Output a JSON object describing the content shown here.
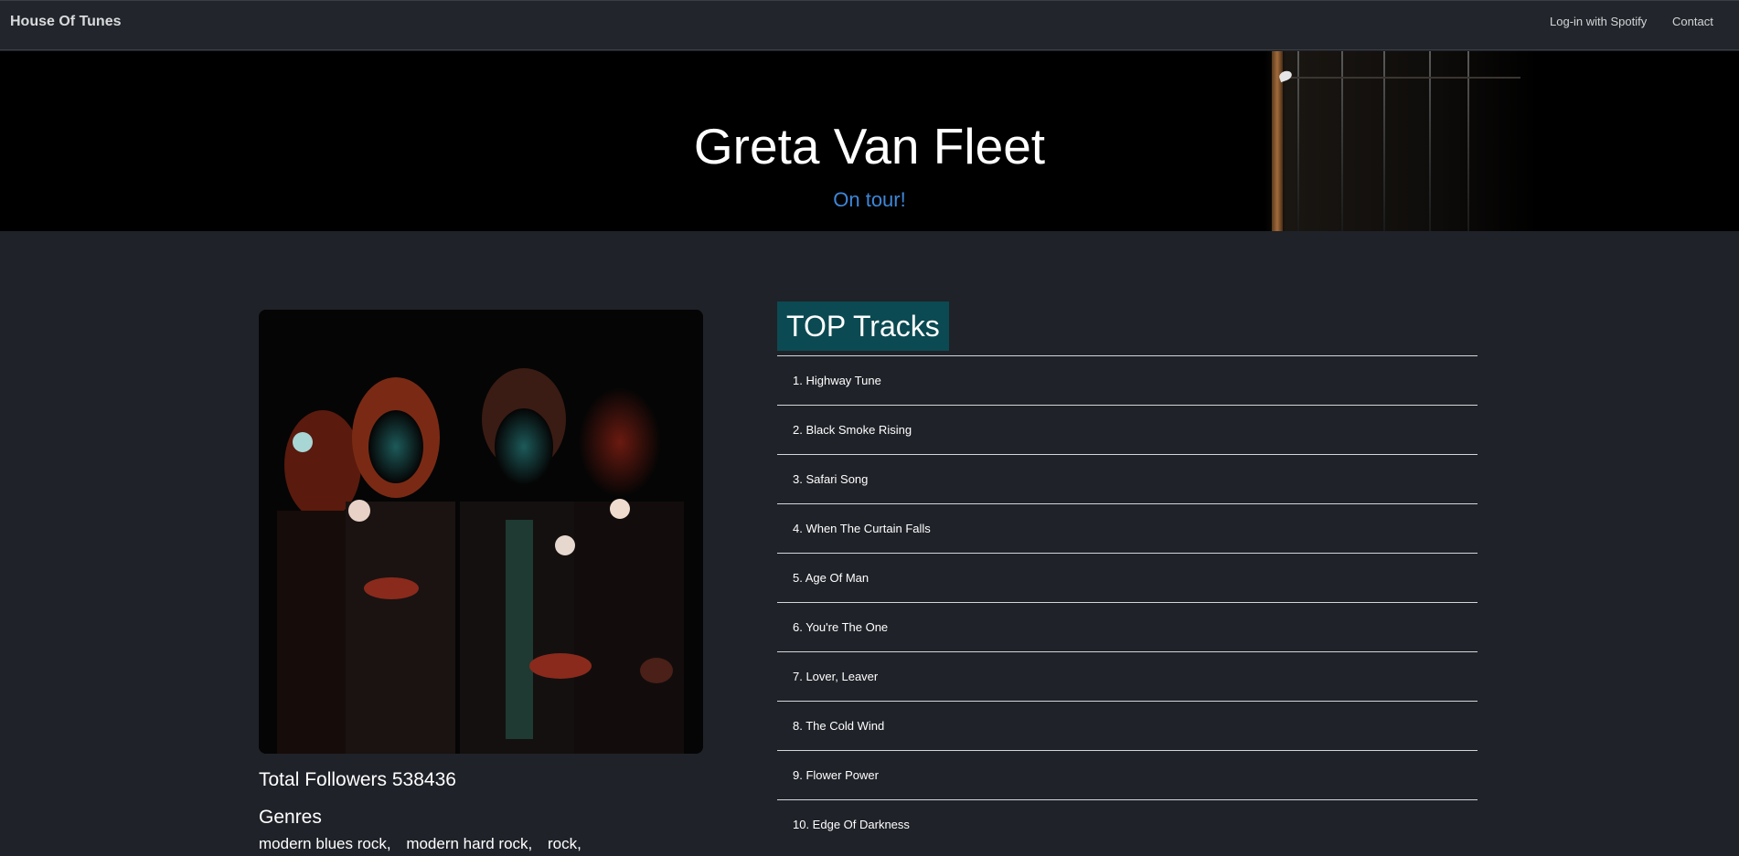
{
  "navbar": {
    "brand": "House Of Tunes",
    "login_label": "Log-in with Spotify",
    "contact_label": "Contact"
  },
  "hero": {
    "artist_name": "Greta Van Fleet",
    "status": "On tour!"
  },
  "artist": {
    "followers_text": "Total Followers 538436",
    "genres_title": "Genres",
    "genres": [
      "modern blues rock,",
      "modern hard rock,",
      "rock,"
    ]
  },
  "top_tracks": {
    "title": "TOP Tracks",
    "tracks": [
      "1. Highway Tune",
      "2. Black Smoke Rising",
      "3. Safari Song",
      "4. When The Curtain Falls",
      "5. Age Of Man",
      "6. You're The One",
      "7. Lover, Leaver",
      "8. The Cold Wind",
      "9. Flower Power",
      "10. Edge Of Darkness"
    ]
  },
  "colors": {
    "background": "#1f2228",
    "navbar": "#22262c",
    "status_accent": "#3f86d8",
    "tracks_title_bg": "#0b4a52"
  }
}
